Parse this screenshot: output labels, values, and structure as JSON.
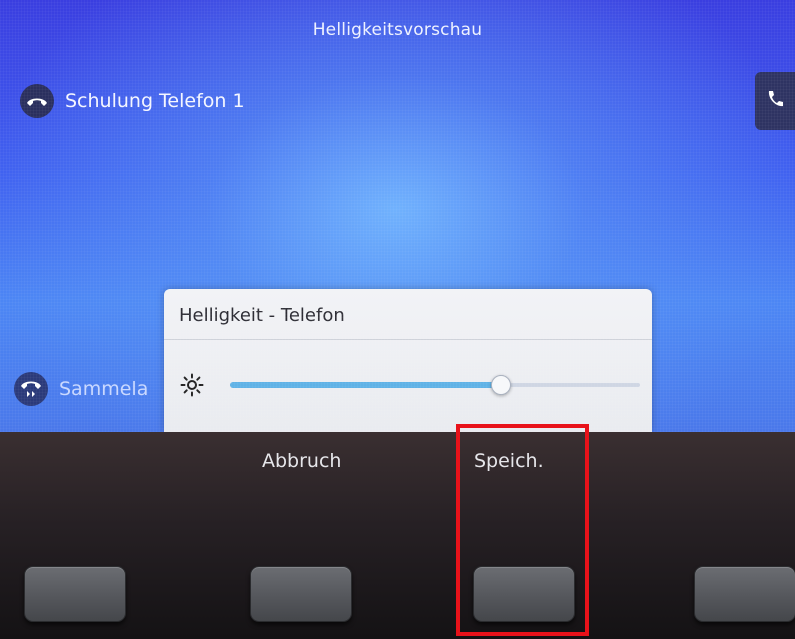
{
  "header": {
    "title": "Helligkeitsvorschau"
  },
  "lines": [
    {
      "label": "Schulung Telefon 1",
      "icon": "handset-icon"
    },
    {
      "label": "Sammela",
      "icon": "shared-line-icon"
    }
  ],
  "call_button": {
    "icon": "phone-icon"
  },
  "dialog": {
    "title": "Helligkeit - Telefon",
    "brightness_icon": "sun-icon",
    "brightness_level": 0.66
  },
  "softkeys": [
    {
      "label": ""
    },
    {
      "label": "Abbruch"
    },
    {
      "label": "Speich."
    },
    {
      "label": ""
    }
  ],
  "colors": {
    "accent": "#5fb2e6",
    "highlight": "#e8121a",
    "screen_blue": "#3f5ff0"
  }
}
